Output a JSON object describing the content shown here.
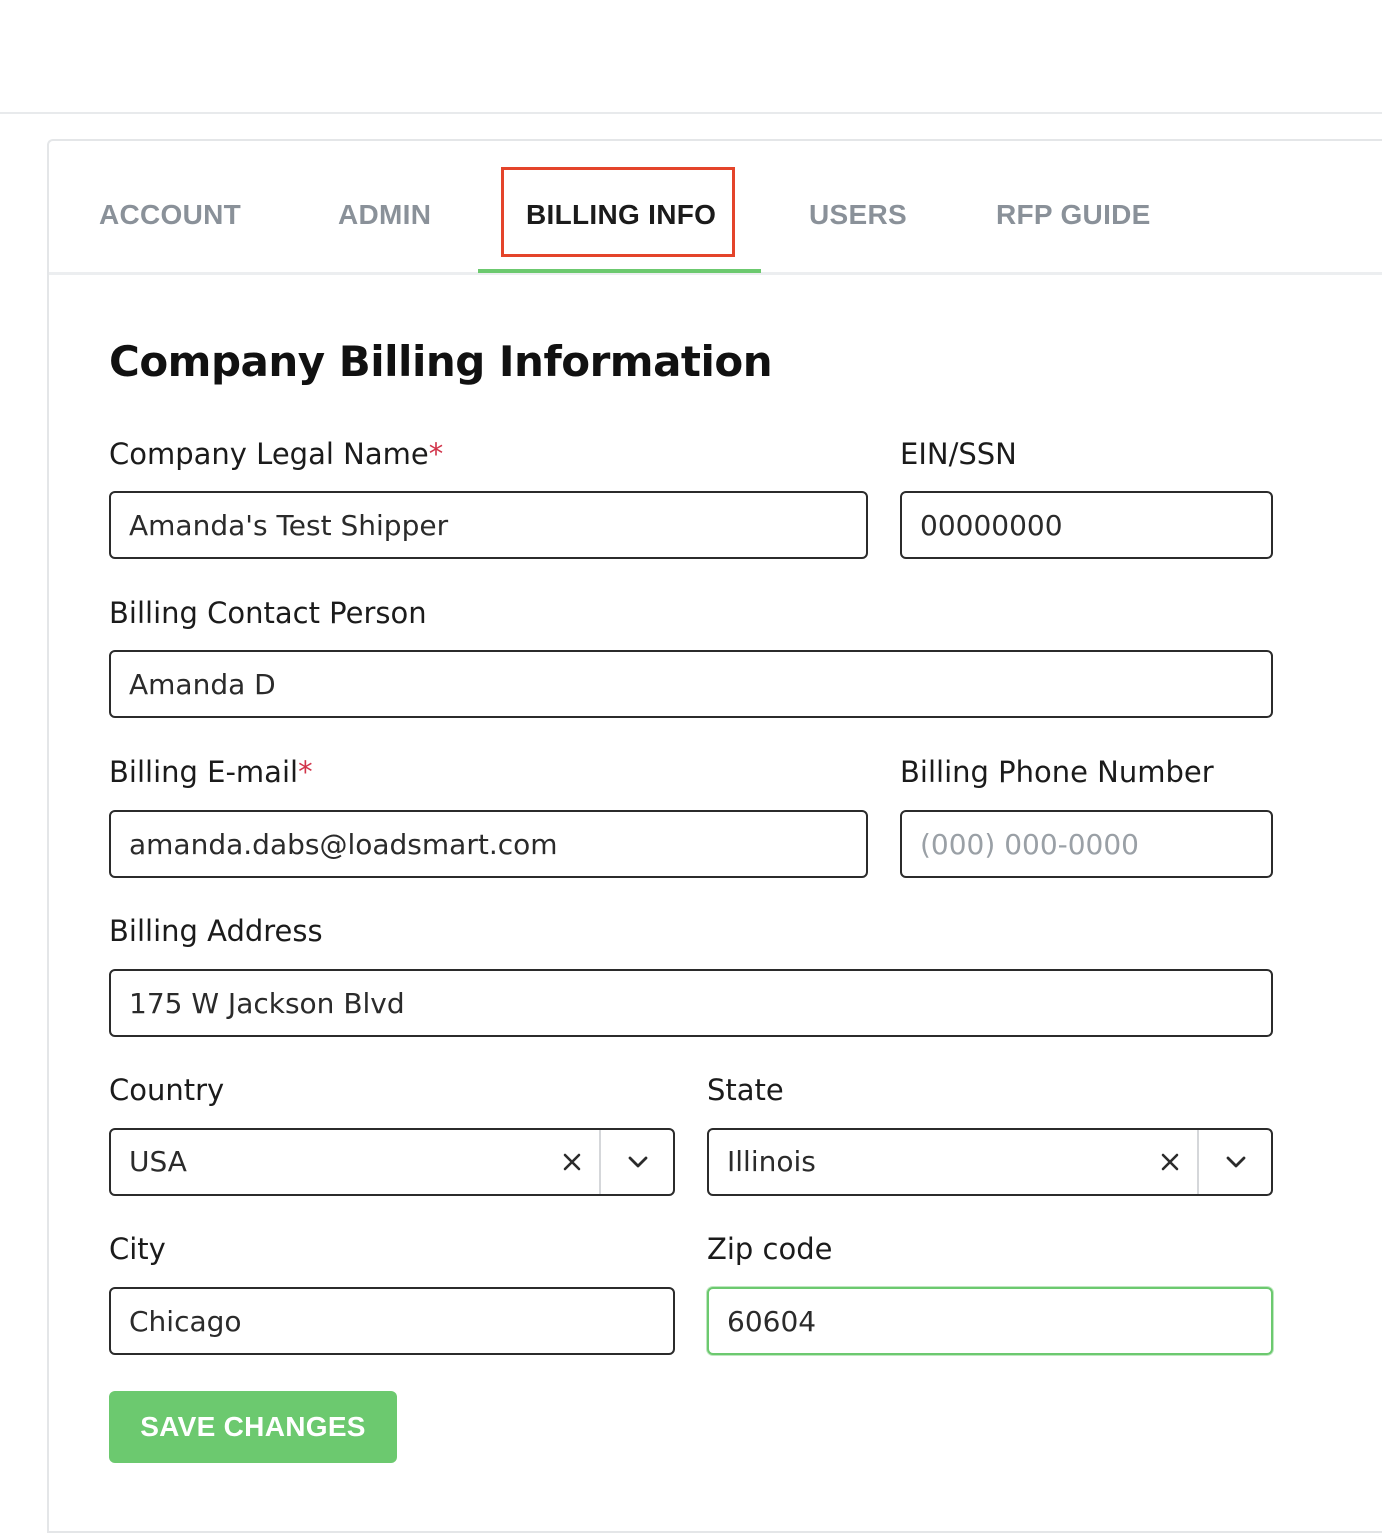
{
  "tabs": [
    {
      "label": "ACCOUNT"
    },
    {
      "label": "ADMIN"
    },
    {
      "label": "BILLING INFO",
      "active": true
    },
    {
      "label": "USERS"
    },
    {
      "label": "RFP GUIDE"
    }
  ],
  "form": {
    "title": "Company Billing Information",
    "legal_name": {
      "label": "Company Legal Name",
      "required_mark": "*",
      "value": "Amanda's Test Shipper"
    },
    "ein": {
      "label": "EIN/SSN",
      "value": "00000000"
    },
    "contact": {
      "label": "Billing Contact Person",
      "value": "Amanda D"
    },
    "email": {
      "label": "Billing E-mail",
      "required_mark": "*",
      "value": "amanda.dabs@loadsmart.com"
    },
    "phone": {
      "label": "Billing Phone Number",
      "value": "",
      "placeholder": "(000) 000-0000"
    },
    "address": {
      "label": "Billing Address",
      "value": "175 W Jackson Blvd"
    },
    "country": {
      "label": "Country",
      "value": "USA"
    },
    "state": {
      "label": "State",
      "value": "Illinois"
    },
    "city": {
      "label": "City",
      "value": "Chicago"
    },
    "zip": {
      "label": "Zip code",
      "value": "60604"
    },
    "save_label": "SAVE CHANGES"
  },
  "colors": {
    "accent": "#6cc96f",
    "highlight": "#e4442a",
    "required": "#d1344a"
  }
}
